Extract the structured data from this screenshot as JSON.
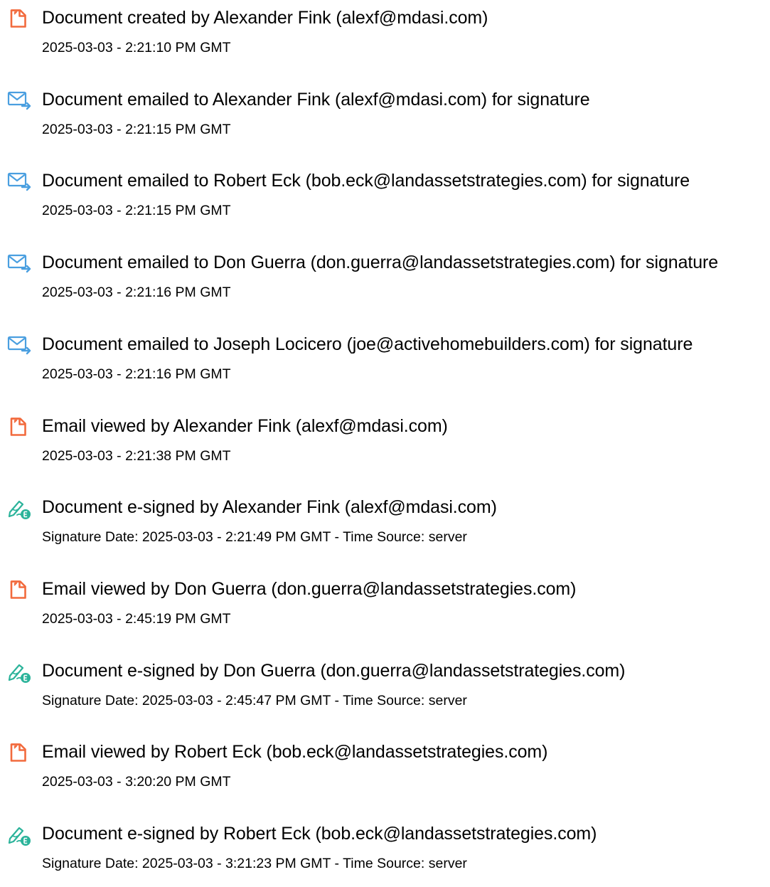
{
  "audit_log": {
    "entries": [
      {
        "icon": "document-icon",
        "title": "Document created by Alexander Fink (alexf@mdasi.com)",
        "detail": "2025-03-03 - 2:21:10 PM GMT"
      },
      {
        "icon": "email-sent-icon",
        "title": "Document emailed to Alexander Fink (alexf@mdasi.com) for signature",
        "detail": "2025-03-03 - 2:21:15 PM GMT"
      },
      {
        "icon": "email-sent-icon",
        "title": "Document emailed to Robert Eck (bob.eck@landassetstrategies.com) for signature",
        "detail": "2025-03-03 - 2:21:15 PM GMT"
      },
      {
        "icon": "email-sent-icon",
        "title": "Document emailed to Don Guerra (don.guerra@landassetstrategies.com) for signature",
        "detail": "2025-03-03 - 2:21:16 PM GMT"
      },
      {
        "icon": "email-sent-icon",
        "title": "Document emailed to Joseph Locicero (joe@activehomebuilders.com) for signature",
        "detail": "2025-03-03 - 2:21:16 PM GMT"
      },
      {
        "icon": "document-icon",
        "title": "Email viewed by Alexander Fink (alexf@mdasi.com)",
        "detail": "2025-03-03 - 2:21:38 PM GMT"
      },
      {
        "icon": "esign-pen-icon",
        "title": "Document e-signed by Alexander Fink (alexf@mdasi.com)",
        "detail": "Signature Date: 2025-03-03 - 2:21:49 PM GMT - Time Source: server"
      },
      {
        "icon": "document-icon",
        "title": "Email viewed by Don Guerra (don.guerra@landassetstrategies.com)",
        "detail": "2025-03-03 - 2:45:19 PM GMT"
      },
      {
        "icon": "esign-pen-icon",
        "title": "Document e-signed by Don Guerra (don.guerra@landassetstrategies.com)",
        "detail": "Signature Date: 2025-03-03 - 2:45:47 PM GMT - Time Source: server"
      },
      {
        "icon": "document-icon",
        "title": "Email viewed by Robert Eck (bob.eck@landassetstrategies.com)",
        "detail": "2025-03-03 - 3:20:20 PM GMT"
      },
      {
        "icon": "esign-pen-icon",
        "title": "Document e-signed by Robert Eck (bob.eck@landassetstrategies.com)",
        "detail": "Signature Date: 2025-03-03 - 3:21:23 PM GMT - Time Source: server"
      }
    ]
  },
  "colors": {
    "document_icon": "#f26a3d",
    "email_icon": "#4a9fe0",
    "esign_icon": "#2bb39a"
  }
}
